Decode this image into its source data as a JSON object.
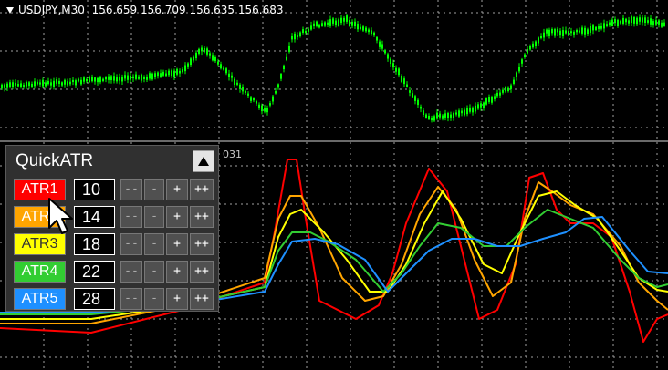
{
  "chart": {
    "symbol": "USDJPY,M30",
    "ohlc": "156.659 156.709 156.635 156.683",
    "subwindow_label": "031"
  },
  "panel": {
    "title": "QuickATR",
    "rows": [
      {
        "label": "ATR1",
        "value": "10",
        "color": "#ff0000",
        "text_color": "#ffffff"
      },
      {
        "label": "ATR2",
        "value": "14",
        "color": "#ffa500",
        "text_color": "#ffffff"
      },
      {
        "label": "ATR3",
        "value": "18",
        "color": "#ffff00",
        "text_color": "#333333"
      },
      {
        "label": "ATR4",
        "value": "22",
        "color": "#32cd32",
        "text_color": "#ffffff"
      },
      {
        "label": "ATR5",
        "value": "28",
        "color": "#1e90ff",
        "text_color": "#ffffff"
      }
    ],
    "buttons": {
      "dec_big": "--",
      "dec": "-",
      "inc": "+",
      "inc_big": "++"
    }
  },
  "colors": {
    "candles": "#00ff00",
    "grid": "#a0a0a0",
    "separator": "#6a6a6a"
  }
}
